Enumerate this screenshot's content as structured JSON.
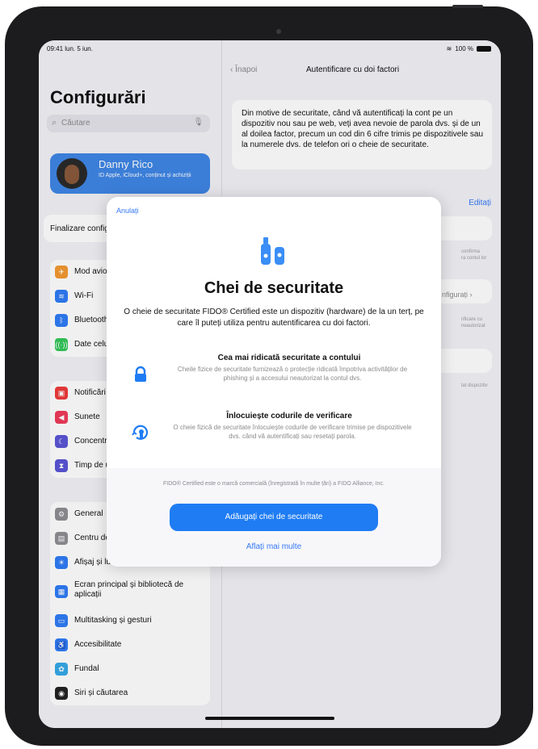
{
  "status": {
    "time": "09:41  lun. 5 iun.",
    "battery_text": "100 %"
  },
  "sidebar": {
    "title": "Configurări",
    "search_placeholder": "Căutare",
    "account": {
      "name": "Danny Rico",
      "subtitle": "ID Apple, iCloud+, conținut și achiziții"
    },
    "finalize_label": "Finalizare configurarea dispozitivului",
    "groups": [
      {
        "items": [
          {
            "label": "Mod avion",
            "icon": "airplane-icon",
            "color": "#f49a31"
          },
          {
            "label": "Wi-Fi",
            "icon": "wifi-icon",
            "color": "#2f7cf6"
          },
          {
            "label": "Bluetooth",
            "icon": "bluetooth-icon",
            "color": "#2f7cf6"
          },
          {
            "label": "Date celulare",
            "icon": "cellular-icon",
            "color": "#34c759"
          }
        ]
      },
      {
        "items": [
          {
            "label": "Notificări",
            "icon": "notifications-icon",
            "color": "#ef3b3a"
          },
          {
            "label": "Sunete",
            "icon": "sounds-icon",
            "color": "#ef3b5b"
          },
          {
            "label": "Concentrare",
            "icon": "focus-icon",
            "color": "#5a56d6"
          },
          {
            "label": "Timp de utilizare",
            "icon": "hourglass-icon",
            "color": "#5a56d6"
          }
        ]
      },
      {
        "items": [
          {
            "label": "General",
            "icon": "gear-icon",
            "color": "#8e8e93"
          },
          {
            "label": "Centru de control",
            "icon": "control-center-icon",
            "color": "#8e8e93"
          },
          {
            "label": "Afișaj și luminozitate",
            "icon": "display-icon",
            "color": "#2f7cf6"
          },
          {
            "label": "Ecran principal și bibliotecă de aplicații",
            "icon": "home-screen-icon",
            "color": "#2f7cf6",
            "tall": true
          },
          {
            "label": "Multitasking și gesturi",
            "icon": "multitasking-icon",
            "color": "#2f7cf6"
          },
          {
            "label": "Accesibilitate",
            "icon": "accessibility-icon",
            "color": "#2f7cf6"
          },
          {
            "label": "Fundal",
            "icon": "wallpaper-icon",
            "color": "#36a9e8"
          },
          {
            "label": "Siri și căutarea",
            "icon": "siri-icon",
            "color": "#222222"
          }
        ]
      }
    ]
  },
  "detail": {
    "back_label": "Înapoi",
    "title": "Autentificare cu doi factori",
    "info": "Din motive de securitate, când vă autentificați la cont pe un dispozitiv nou sau pe web, veți avea nevoie de parola dvs. și de un al doilea factor, precum un cod din 6 cifre trimis pe dispozitivele sau la numerele dvs. de telefon ori o cheie de securitate.",
    "edit_label": "Editați",
    "configure_label": "nfigurați",
    "faint_1": "confirma",
    "faint_1b": "ra contul lor",
    "faint_2": "rificare cu",
    "faint_2b": "neautorizat",
    "faint_3": "lat dispozitiv"
  },
  "modal": {
    "cancel_label": "Anulați",
    "title": "Chei de securitate",
    "description": "O cheie de securitate FIDO® Certified este un dispozitiv (hardware) de la un terț, pe care îl puteți utiliza pentru autentificarea cu doi factori.",
    "features": [
      {
        "heading": "Cea mai ridicată securitate a contului",
        "body": "Cheile fizice de securitate furnizează o protecție ridicată împotriva activităților de phishing și a accesului neautorizat la contul dvs."
      },
      {
        "heading": "Înlocuiește codurile de verificare",
        "body": "O cheie fizică de securitate înlocuiește codurile de verificare trimise pe dispozitivele dvs. când vă autentificați sau resetați parola."
      }
    ],
    "legal": "FIDO® Certified este o marcă comercială (înregistrată în multe țări) a FIDO Alliance, Inc.",
    "primary_label": "Adăugați chei de securitate",
    "learn_more_label": "Aflați mai multe",
    "accent": "#1f7cf3"
  }
}
